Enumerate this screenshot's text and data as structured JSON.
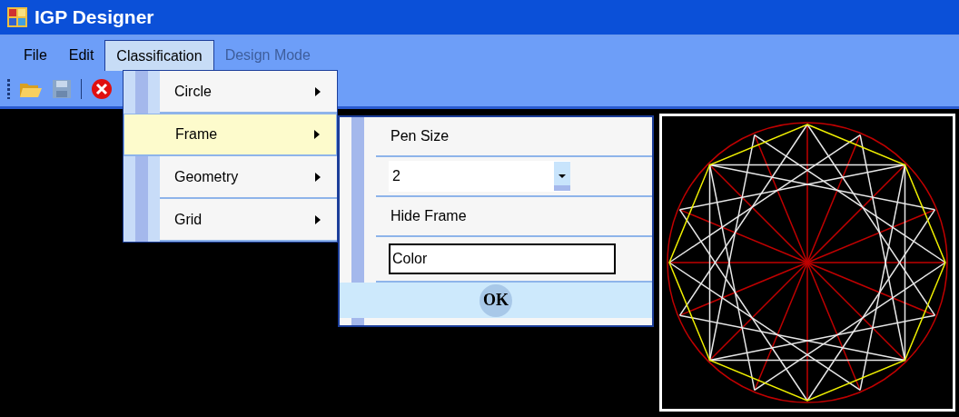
{
  "window": {
    "title": "IGP Designer"
  },
  "menu_bar": [
    {
      "label": "File",
      "open": false,
      "disabled": false
    },
    {
      "label": "Edit",
      "open": false,
      "disabled": false
    },
    {
      "label": "Classification",
      "open": true,
      "disabled": false
    },
    {
      "label": "Design Mode",
      "open": false,
      "disabled": true
    }
  ],
  "classification_menu": [
    {
      "label": "Circle",
      "selected": false
    },
    {
      "label": "Frame",
      "selected": true
    },
    {
      "label": "Geometry",
      "selected": false
    },
    {
      "label": "Grid",
      "selected": false
    }
  ],
  "frame_submenu": {
    "pen_size_label": "Pen Size",
    "pen_size": "2",
    "hide_frame": "Hide Frame",
    "color_field": "Color",
    "ok_button": "OK"
  }
}
